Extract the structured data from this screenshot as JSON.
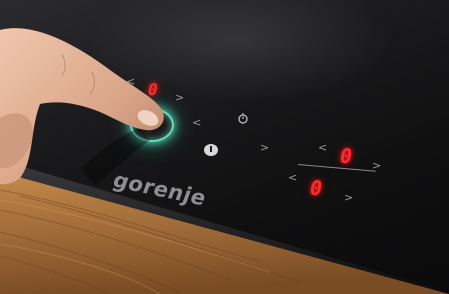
{
  "brand": {
    "name": "gorenje"
  },
  "displays": {
    "left_zone": "0",
    "right_top_zone": "0",
    "right_bottom_zone": "0"
  },
  "controls": {
    "chevron_left": "<",
    "chevron_right": ">"
  },
  "icons": {
    "power": "power-icon",
    "timer": "timer-icon",
    "touch_glow": "touch-glow-icon"
  },
  "colors": {
    "display": "#ff2a2a",
    "touch_glow": "#78ffdc",
    "glass": "#141415",
    "wood": "#a9743f"
  }
}
